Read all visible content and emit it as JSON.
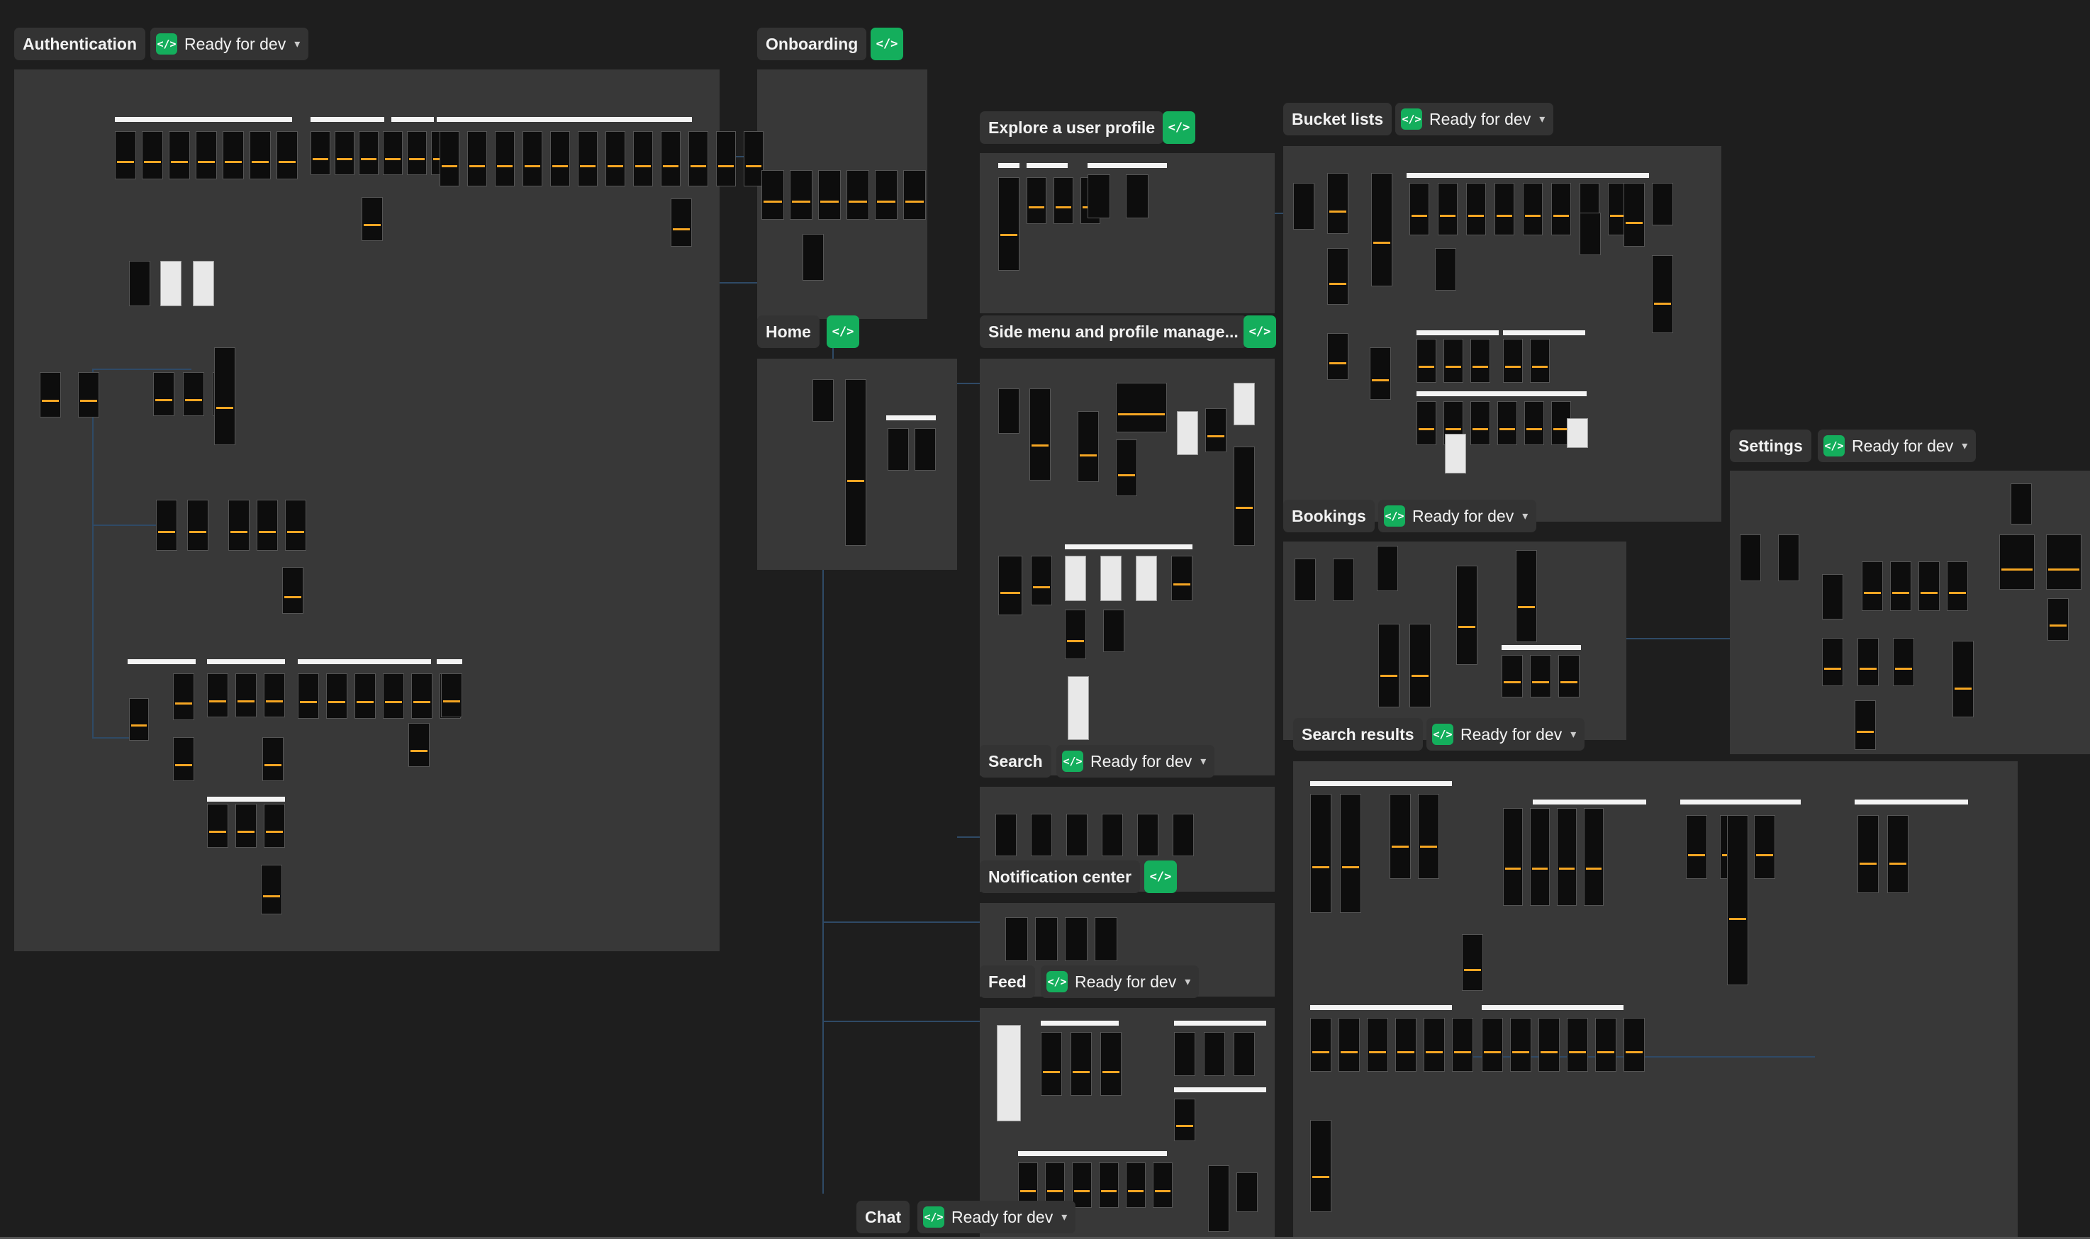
{
  "sections": {
    "authentication": {
      "title": "Authentication",
      "status": "Ready for dev"
    },
    "onboarding": {
      "title": "Onboarding"
    },
    "explore_profile": {
      "title": "Explore a user profile"
    },
    "bucket_lists": {
      "title": "Bucket lists",
      "status": "Ready for dev"
    },
    "home": {
      "title": "Home"
    },
    "side_menu": {
      "title": "Side menu and profile manage..."
    },
    "settings": {
      "title": "Settings",
      "status": "Ready for dev"
    },
    "bookings": {
      "title": "Bookings",
      "status": "Ready for dev"
    },
    "search_results": {
      "title": "Search results",
      "status": "Ready for dev"
    },
    "search": {
      "title": "Search",
      "status": "Ready for dev"
    },
    "notification_center": {
      "title": "Notification center"
    },
    "feed": {
      "title": "Feed",
      "status": "Ready for dev"
    },
    "chat": {
      "title": "Chat",
      "status": "Ready for dev"
    }
  },
  "icons": {
    "code": "code-brackets-icon",
    "chevron": "chevron-down-icon"
  },
  "colors": {
    "canvas_bg": "#1e1e1e",
    "section_bg": "#383838",
    "ready_green": "#14ae5c",
    "screen_accent": "#f5a623"
  }
}
